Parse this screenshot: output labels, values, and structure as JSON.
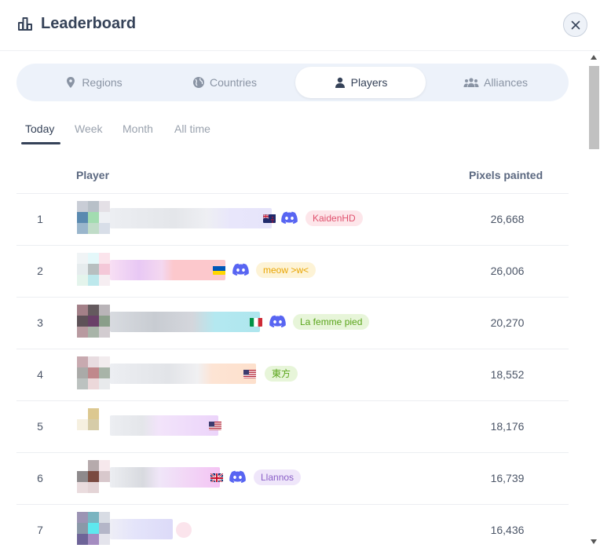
{
  "header": {
    "title": "Leaderboard",
    "icon": "bar-chart-icon",
    "close_icon": "close-icon"
  },
  "tabs": [
    {
      "label": "Regions",
      "icon": "map-pin-icon"
    },
    {
      "label": "Countries",
      "icon": "globe-icon"
    },
    {
      "label": "Players",
      "icon": "person-icon",
      "active": true
    },
    {
      "label": "Alliances",
      "icon": "group-icon"
    }
  ],
  "periods": [
    {
      "label": "Today",
      "active": true
    },
    {
      "label": "Week"
    },
    {
      "label": "Month"
    },
    {
      "label": "All time"
    }
  ],
  "table": {
    "columns": {
      "player": "Player",
      "pixels": "Pixels painted"
    },
    "rows": [
      {
        "rank": "1",
        "pixels": "26,668",
        "flag": "New Zealand",
        "discord": true,
        "tag": "KaidenHD",
        "tag_color": "#e0526e",
        "tag_bg": "#fde6ea"
      },
      {
        "rank": "2",
        "pixels": "26,006",
        "flag": "Ukraine",
        "discord": true,
        "tag": "meow >w<",
        "tag_color": "#e8a400",
        "tag_bg": "#fdf3d6"
      },
      {
        "rank": "3",
        "pixels": "20,270",
        "flag": "Italy",
        "discord": true,
        "tag": "La femme pied",
        "tag_color": "#5aa51b",
        "tag_bg": "#e7f5d9"
      },
      {
        "rank": "4",
        "pixels": "18,552",
        "flag": "United States",
        "discord": false,
        "tag": "東方",
        "tag_color": "#5aa51b",
        "tag_bg": "#e7f5d9"
      },
      {
        "rank": "5",
        "pixels": "18,176",
        "flag": "United States",
        "discord": false,
        "tag": ""
      },
      {
        "rank": "6",
        "pixels": "16,739",
        "flag": "United Kingdom",
        "discord": true,
        "tag": "Llannos",
        "tag_color": "#8a5fc7",
        "tag_bg": "#efe6fa"
      },
      {
        "rank": "7",
        "pixels": "16,436",
        "flag": "",
        "discord": false,
        "tag": ""
      }
    ]
  }
}
